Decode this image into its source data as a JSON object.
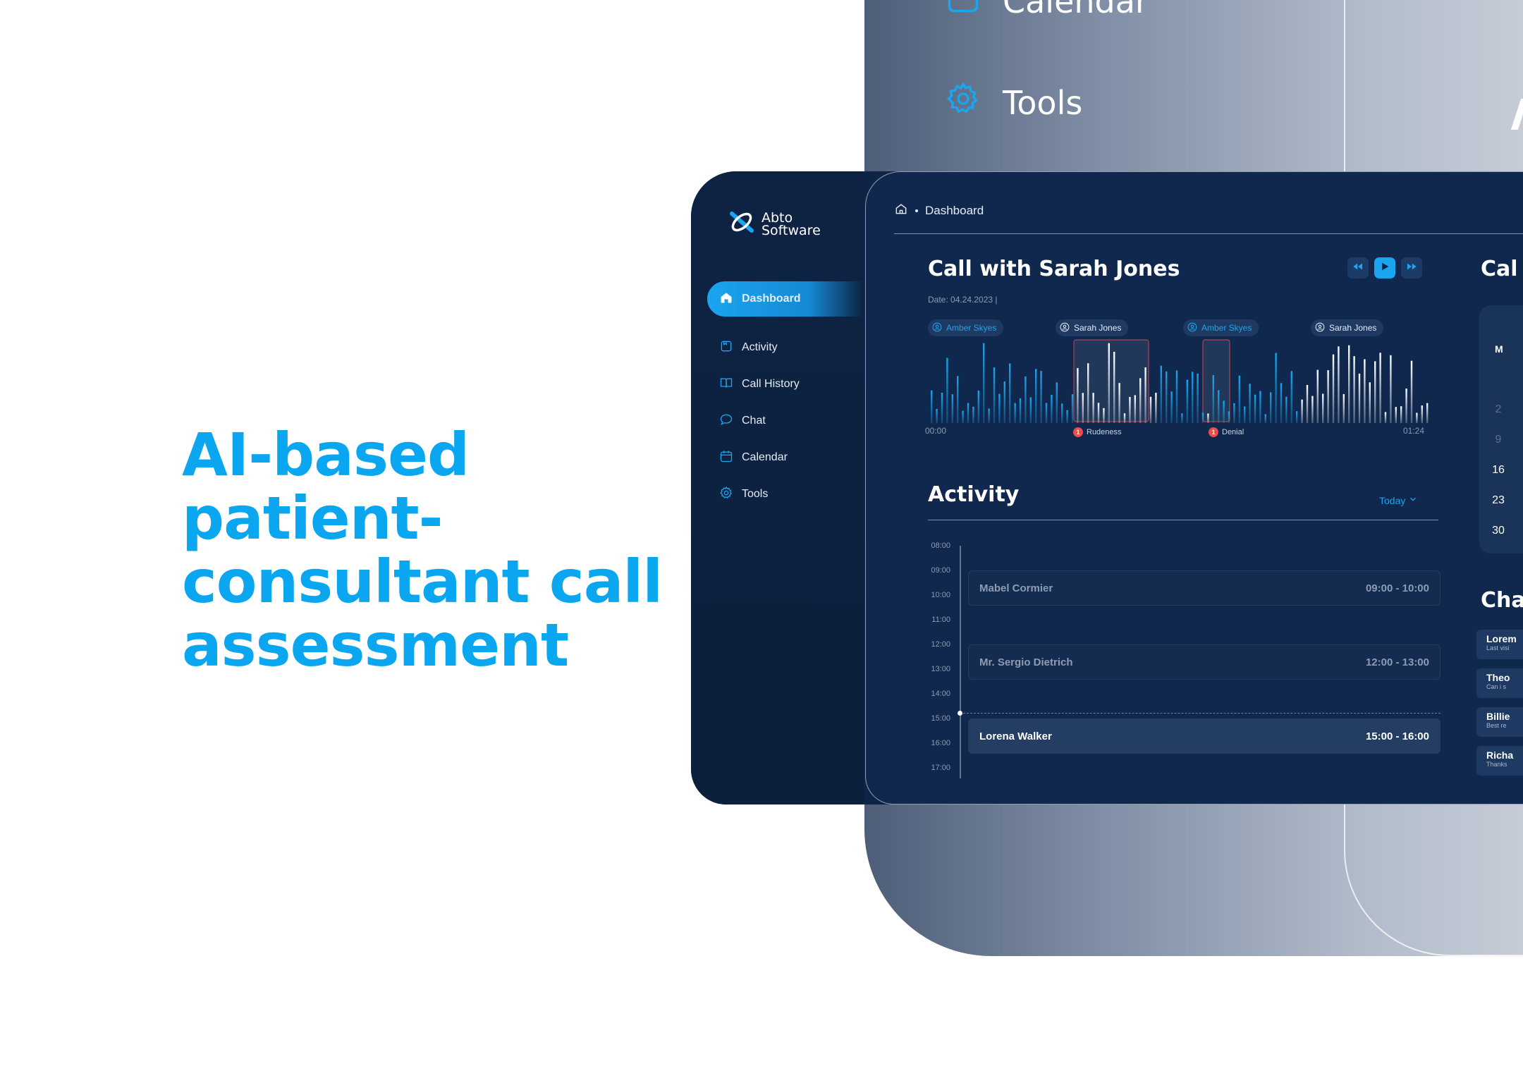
{
  "background": {
    "nav_items": [
      {
        "label": "Calendar",
        "icon": "calendar-icon"
      },
      {
        "label": "Tools",
        "icon": "gear-icon"
      }
    ]
  },
  "headline": {
    "lines": [
      "AI-based",
      "patient-",
      "consultant call",
      "assessment"
    ]
  },
  "brand": {
    "line1": "Abto",
    "line2": "Software"
  },
  "sidebar": {
    "items": [
      {
        "label": "Dashboard",
        "icon": "home-icon",
        "active": true
      },
      {
        "label": "Activity",
        "icon": "activity-icon"
      },
      {
        "label": "Call History",
        "icon": "book-icon"
      },
      {
        "label": "Chat",
        "icon": "chat-bubble-icon"
      },
      {
        "label": "Calendar",
        "icon": "calendar-icon"
      },
      {
        "label": "Tools",
        "icon": "gear-icon"
      }
    ]
  },
  "breadcrumb": {
    "current": "Dashboard"
  },
  "call": {
    "title": "Call with Sarah Jones",
    "date": "Date: 04.24.2023 |",
    "start_time": "00:00",
    "end_time": "01:24",
    "speakers": [
      {
        "name": "Amber Skyes",
        "color": "blue"
      },
      {
        "name": "Sarah Jones",
        "color": "white"
      },
      {
        "name": "Amber Skyes",
        "color": "blue"
      },
      {
        "name": "Sarah Jones",
        "color": "white"
      }
    ],
    "flags": [
      {
        "count": "1",
        "label": "Rudeness"
      },
      {
        "count": "1",
        "label": "Denial"
      }
    ]
  },
  "activity": {
    "title": "Activity",
    "filter": "Today",
    "hours": [
      "08:00",
      "09:00",
      "10:00",
      "11:00",
      "12:00",
      "13:00",
      "14:00",
      "15:00",
      "16:00",
      "17:00"
    ],
    "events": [
      {
        "name": "Mabel Cormier",
        "time": "09:00 - 10:00",
        "active": false
      },
      {
        "name": "Mr. Sergio Dietrich",
        "time": "12:00 - 13:00",
        "active": false
      },
      {
        "name": "Lorena Walker",
        "time": "15:00 - 16:00",
        "active": true
      }
    ]
  },
  "calendar": {
    "title": "Cal",
    "day_header": "M",
    "dates": [
      "2",
      "9",
      "16",
      "23",
      "30"
    ]
  },
  "chat": {
    "title": "Cha",
    "items": [
      {
        "name": "Lorem",
        "preview": "Last visi"
      },
      {
        "name": "Theo",
        "preview": "Can i s"
      },
      {
        "name": "Billie",
        "preview": "Best re"
      },
      {
        "name": "Richa",
        "preview": "Thanks"
      }
    ]
  },
  "colors": {
    "accent": "#1aa5ef",
    "headline": "#0aa7f0",
    "app_bg": "#10284d",
    "sidebar_bg": "#0e2344",
    "flag": "#ea4b4b"
  }
}
